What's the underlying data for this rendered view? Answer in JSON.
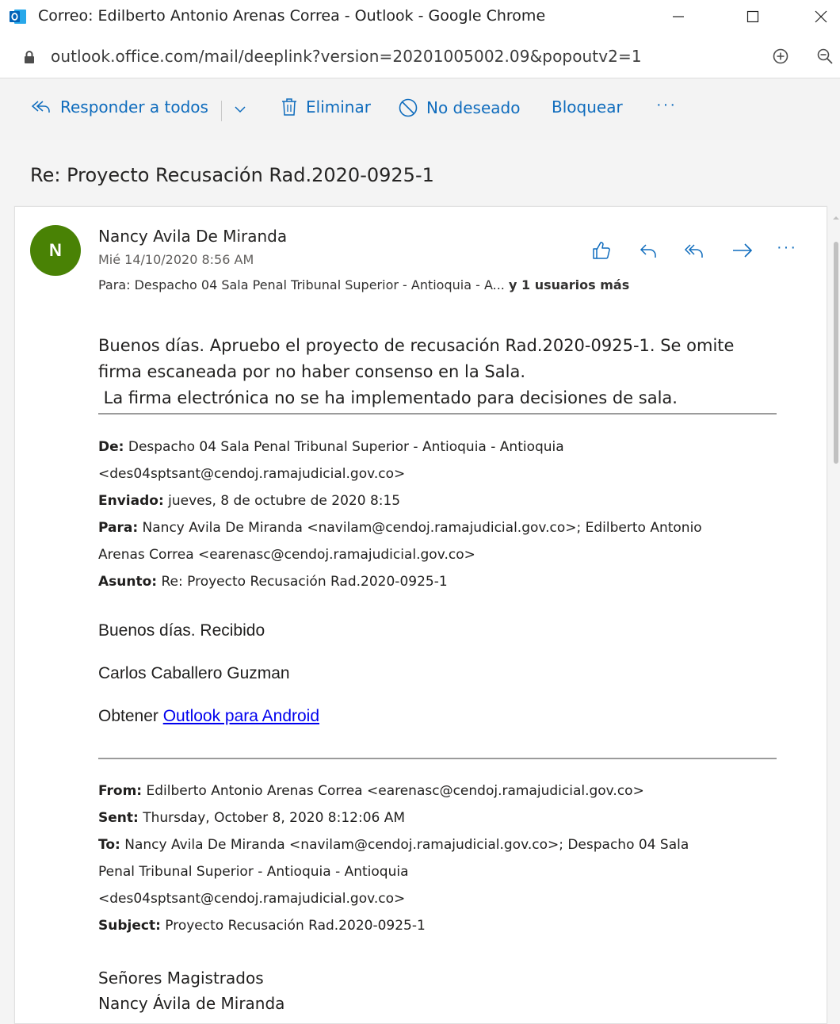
{
  "window": {
    "title": "Correo: Edilberto Antonio Arenas Correa - Outlook - Google Chrome",
    "url": "outlook.office.com/mail/deeplink?version=20201005002.09&popoutv2=1"
  },
  "toolbar": {
    "reply_all": "Responder a todos",
    "delete": "Eliminar",
    "junk": "No deseado",
    "block": "Bloquear",
    "more": "···"
  },
  "message": {
    "subject": "Re: Proyecto Recusación Rad.2020-0925-1",
    "avatar_initial": "N",
    "avatar_color": "#498205",
    "sender": "Nancy Avila De Miranda",
    "date": "Mié 14/10/2020 8:56 AM",
    "to_label": "Para:",
    "to_value": "Despacho 04 Sala Penal Tribunal Superior - Antioquia - A...",
    "to_more": "y 1 usuarios más",
    "more": "···",
    "body_lines": [
      "Buenos días. Apruebo el proyecto de recusación Rad.2020-0925-1. Se omite",
      "firma escaneada por no haber consenso en la Sala.",
      " La firma electrónica no se ha implementado para decisiones de sala."
    ]
  },
  "quoted1": {
    "from_label": "De:",
    "from_value": " Despacho 04 Sala Penal Tribunal Superior - Antioquia - Antioquia",
    "from_email": "<des04sptsant@cendoj.ramajudicial.gov.co>",
    "sent_label": "Enviado:",
    "sent_value": " jueves, 8 de octubre de 2020 8:15",
    "to_label": "Para:",
    "to_value_line1": " Nancy Avila De Miranda <navilam@cendoj.ramajudicial.gov.co>; Edilberto Antonio",
    "to_value_line2": "Arenas Correa <earenasc@cendoj.ramajudicial.gov.co>",
    "subject_label": "Asunto:",
    "subject_value": " Re: Proyecto Recusación Rad.2020-0925-1",
    "reply": "Buenos días. Recibido",
    "signature": "Carlos Caballero Guzman",
    "get_prefix": "Obtener ",
    "get_link": "Outlook para Android"
  },
  "quoted2": {
    "from_label": "From:",
    "from_value": " Edilberto Antonio Arenas Correa <earenasc@cendoj.ramajudicial.gov.co>",
    "sent_label": "Sent:",
    "sent_value": " Thursday, October 8, 2020 8:12:06 AM",
    "to_label": "To:",
    "to_value_line1": " Nancy Avila De Miranda <navilam@cendoj.ramajudicial.gov.co>; Despacho 04 Sala",
    "to_value_line2": "Penal Tribunal Superior - Antioquia - Antioquia",
    "to_value_line3": "<des04sptsant@cendoj.ramajudicial.gov.co>",
    "subject_label": "Subject:",
    "subject_value": " Proyecto Recusación Rad.2020-0925-1",
    "greeting": "Señores Magistrados",
    "name": "Nancy Ávila de Miranda"
  },
  "colors": {
    "accent": "#0f6cbd",
    "outlook_icon": "#0364b8"
  }
}
